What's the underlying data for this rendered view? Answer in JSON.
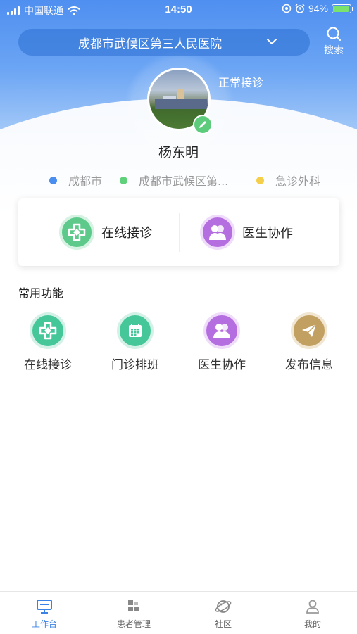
{
  "status_bar": {
    "carrier": "中国联通",
    "time": "14:50",
    "battery": "94%"
  },
  "header": {
    "hospital_name": "成都市武候区第三人民医院",
    "search_label": "搜索",
    "status": "正常接诊"
  },
  "profile": {
    "name": "杨东明",
    "tags": [
      {
        "label": "成都市",
        "color": "#4a8ef0"
      },
      {
        "label": "成都市武候区第...",
        "color": "#5fd17a"
      },
      {
        "label": "急诊外科",
        "color": "#f5cf4b"
      }
    ]
  },
  "quick_actions": [
    {
      "label": "在线接诊",
      "icon": "cross-icon"
    },
    {
      "label": "医生协作",
      "icon": "doctors-icon"
    }
  ],
  "common_functions": {
    "title": "常用功能",
    "items": [
      {
        "label": "在线接诊",
        "icon": "cross-icon"
      },
      {
        "label": "门诊排班",
        "icon": "calendar-icon"
      },
      {
        "label": "医生协作",
        "icon": "doctors-icon"
      },
      {
        "label": "发布信息",
        "icon": "paper-plane-icon"
      }
    ]
  },
  "tab_bar": {
    "tabs": [
      {
        "label": "工作台",
        "icon": "monitor-icon",
        "active": true
      },
      {
        "label": "患者管理",
        "icon": "blocks-icon",
        "active": false
      },
      {
        "label": "社区",
        "icon": "planet-icon",
        "active": false
      },
      {
        "label": "我的",
        "icon": "person-icon",
        "active": false
      }
    ],
    "active_color": "#3b82e6"
  }
}
